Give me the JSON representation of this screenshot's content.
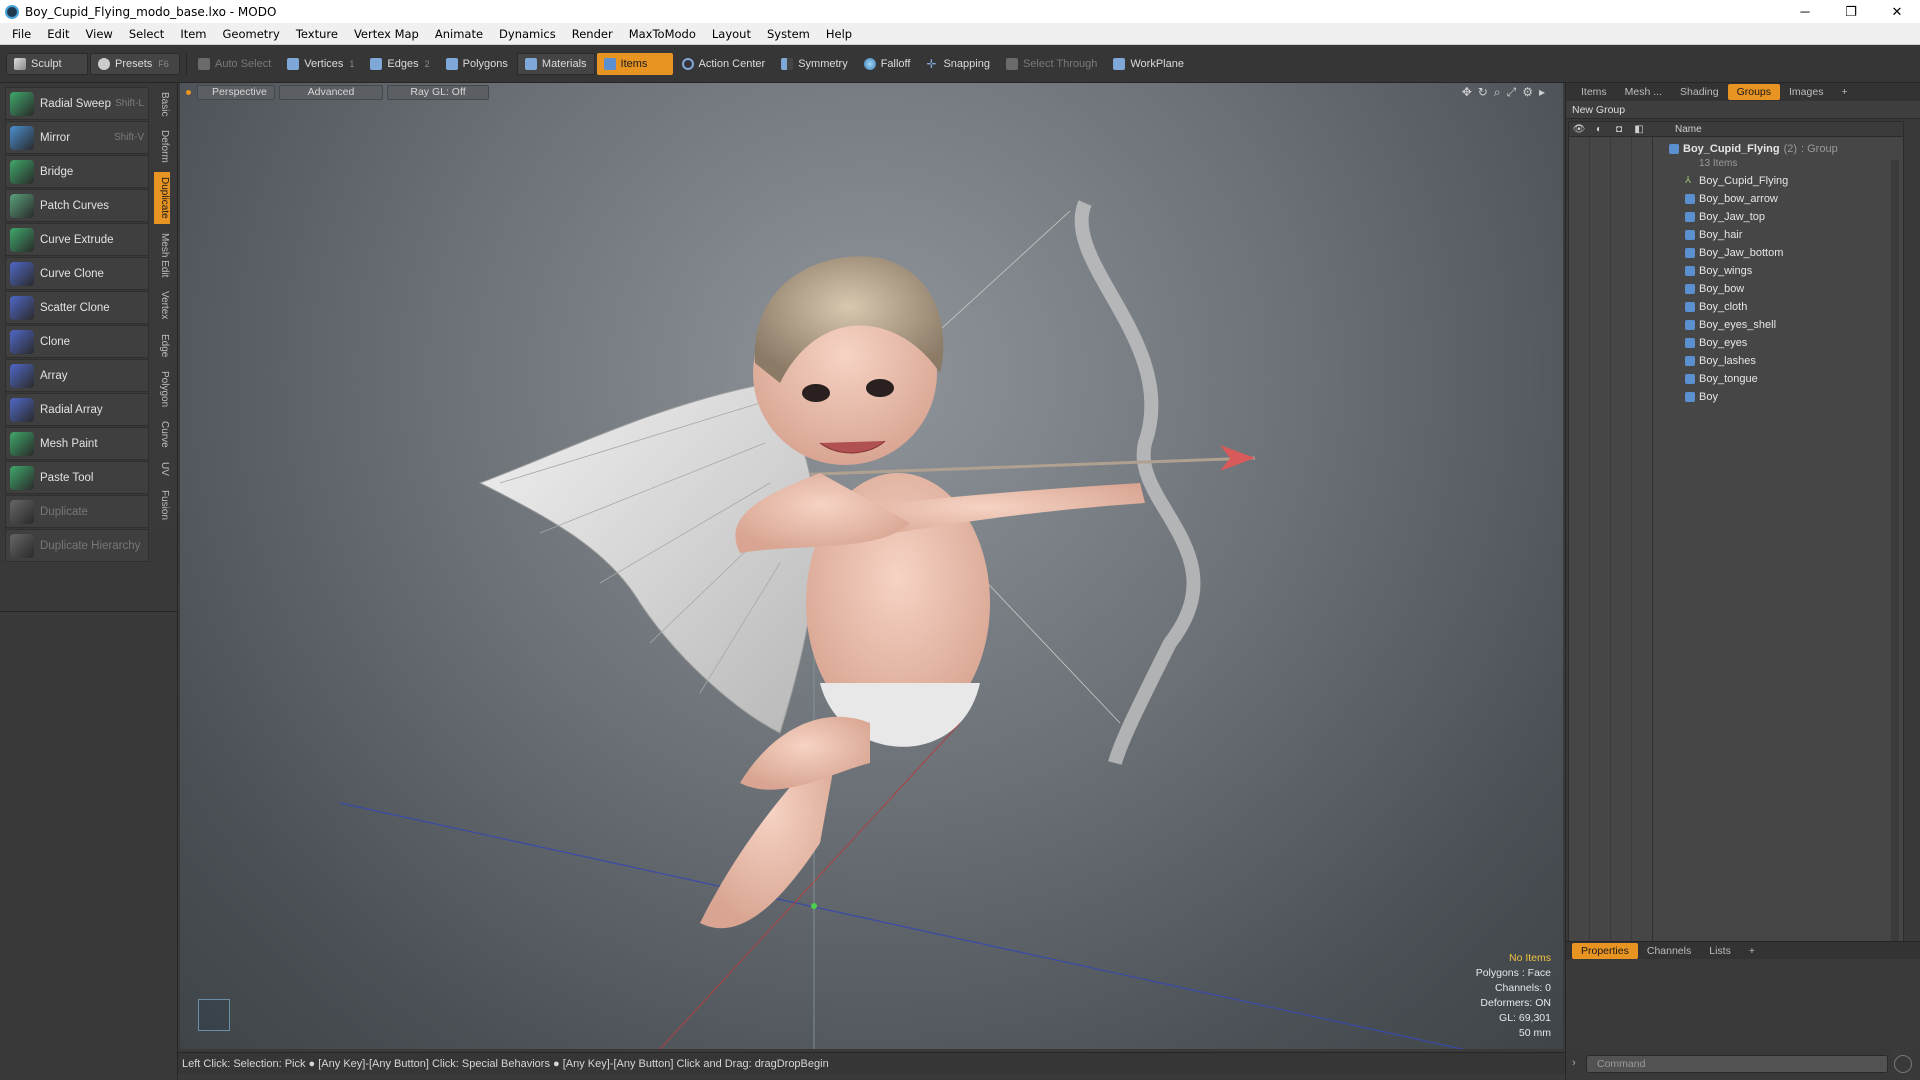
{
  "window": {
    "title": "Boy_Cupid_Flying_modo_base.lxo - MODO",
    "controls": {
      "minimize": "─",
      "maximize": "❐",
      "close": "✕"
    }
  },
  "menu": [
    "File",
    "Edit",
    "View",
    "Select",
    "Item",
    "Geometry",
    "Texture",
    "Vertex Map",
    "Animate",
    "Dynamics",
    "Render",
    "MaxToModo",
    "Layout",
    "System",
    "Help"
  ],
  "toolbar": {
    "sculpt": "Sculpt",
    "presets": "Presets",
    "presets_key": "F6",
    "auto_select": "Auto Select",
    "vertices": "Vertices",
    "vertices_num": "1",
    "edges": "Edges",
    "edges_num": "2",
    "polygons": "Polygons",
    "materials": "Materials",
    "items": "Items",
    "action_center": "Action Center",
    "symmetry": "Symmetry",
    "falloff": "Falloff",
    "snapping": "Snapping",
    "select_through": "Select Through",
    "workplane": "WorkPlane"
  },
  "tools": [
    {
      "label": "Radial Sweep",
      "shortcut": "Shift-L",
      "color": "#3fa86a",
      "enabled": true
    },
    {
      "label": "Mirror",
      "shortcut": "Shift-V",
      "color": "#4a8fd0",
      "enabled": true
    },
    {
      "label": "Bridge",
      "shortcut": "",
      "color": "#3fa86a",
      "enabled": true
    },
    {
      "label": "Patch Curves",
      "shortcut": "",
      "color": "#5aa07a",
      "enabled": true
    },
    {
      "label": "Curve Extrude",
      "shortcut": "",
      "color": "#3fa86a",
      "enabled": true
    },
    {
      "label": "Curve Clone",
      "shortcut": "",
      "color": "#5068c8",
      "enabled": true
    },
    {
      "label": "Scatter Clone",
      "shortcut": "",
      "color": "#5068c8",
      "enabled": true
    },
    {
      "label": "Clone",
      "shortcut": "",
      "color": "#5068c8",
      "enabled": true
    },
    {
      "label": "Array",
      "shortcut": "",
      "color": "#5068c8",
      "enabled": true
    },
    {
      "label": "Radial Array",
      "shortcut": "",
      "color": "#5068c8",
      "enabled": true
    },
    {
      "label": "Mesh Paint",
      "shortcut": "",
      "color": "#3fa86a",
      "enabled": true
    },
    {
      "label": "Paste Tool",
      "shortcut": "",
      "color": "#3fa86a",
      "enabled": true
    },
    {
      "label": "Duplicate",
      "shortcut": "",
      "color": "#666666",
      "enabled": false
    },
    {
      "label": "Duplicate Hierarchy",
      "shortcut": "",
      "color": "#666666",
      "enabled": false
    }
  ],
  "side_tabs": [
    "Basic",
    "Deform",
    "Duplicate",
    "Mesh Edit",
    "Vertex",
    "Edge",
    "Polygon",
    "Curve",
    "UV",
    "Fusion"
  ],
  "viewport": {
    "view_mode": "Perspective",
    "shading": "Advanced",
    "raygl": "Ray GL: Off",
    "info": {
      "selection": "No Items",
      "polygons": "Polygons : Face",
      "channels": "Channels: 0",
      "deformers": "Deformers: ON",
      "gl": "GL: 69,301",
      "size": "50 mm"
    }
  },
  "right_panel": {
    "tabs": [
      "Items",
      "Mesh ...",
      "Shading",
      "Groups",
      "Images"
    ],
    "active_tab": "Groups",
    "new_group": "New Group",
    "name_header": "Name",
    "group": {
      "name": "Boy_Cupid_Flying",
      "count": "(2)",
      "type": ": Group",
      "items_label": "13 Items"
    },
    "items": [
      "Boy_Cupid_Flying",
      "Boy_bow_arrow",
      "Boy_Jaw_top",
      "Boy_hair",
      "Boy_Jaw_bottom",
      "Boy_wings",
      "Boy_bow",
      "Boy_cloth",
      "Boy_eyes_shell",
      "Boy_eyes",
      "Boy_lashes",
      "Boy_tongue",
      "Boy"
    ],
    "prop_tabs": [
      "Properties",
      "Channels",
      "Lists"
    ],
    "command_placeholder": "Command"
  },
  "status": {
    "text": "Left Click: Selection: Pick ● [Any Key]-[Any Button] Click: Special Behaviors ● [Any Key]-[Any Button] Click and Drag: dragDropBegin"
  },
  "colors": {
    "accent": "#e89423",
    "panel": "#393939",
    "viewport_light": "#8f959a",
    "viewport_dark": "#3f4448"
  }
}
